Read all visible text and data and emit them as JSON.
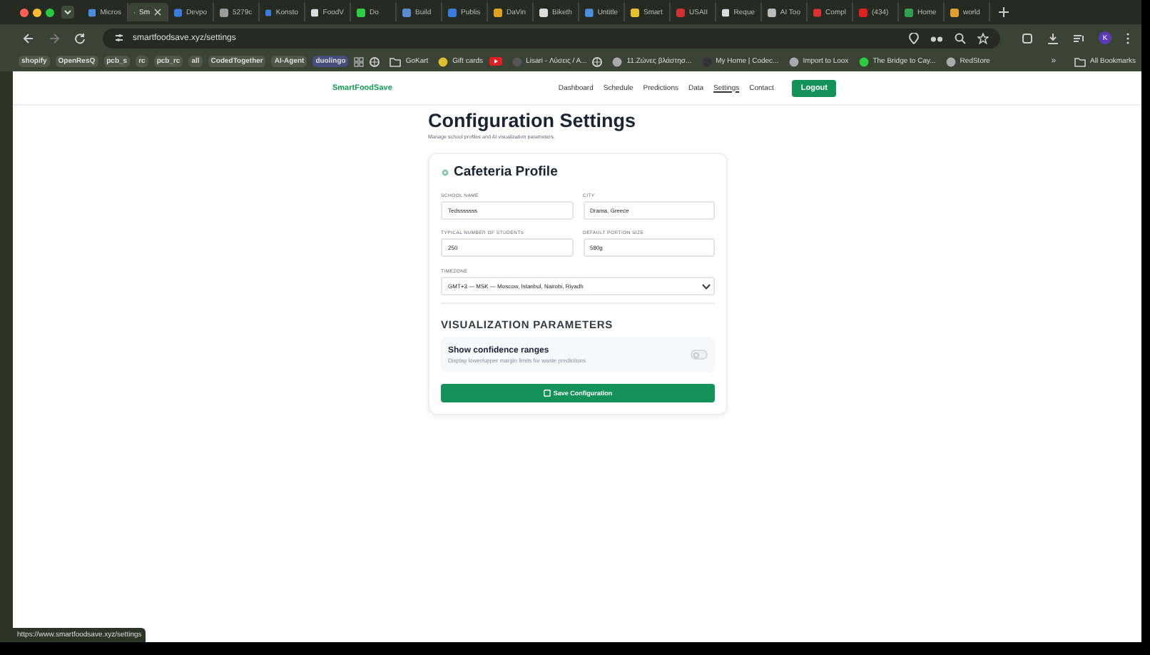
{
  "browser": {
    "tabs": [
      {
        "title": "Micros",
        "selected": false
      },
      {
        "title": "Sm",
        "selected": true
      },
      {
        "title": "Devpo",
        "selected": false
      },
      {
        "title": "5279c",
        "selected": false
      },
      {
        "title": "Konsto",
        "selected": false
      },
      {
        "title": "FoodV",
        "selected": false
      },
      {
        "title": "Do",
        "selected": false
      },
      {
        "title": "Build",
        "selected": false
      },
      {
        "title": "Publis",
        "selected": false
      },
      {
        "title": "DaVin",
        "selected": false
      },
      {
        "title": "Biketh",
        "selected": false
      },
      {
        "title": "Untitle",
        "selected": false
      },
      {
        "title": "Smart",
        "selected": false
      },
      {
        "title": "USAII",
        "selected": false
      },
      {
        "title": "Reque",
        "selected": false
      },
      {
        "title": "AI Too",
        "selected": false
      },
      {
        "title": "Compl",
        "selected": false
      },
      {
        "title": "(434)",
        "selected": false
      },
      {
        "title": "Home",
        "selected": false
      },
      {
        "title": "world",
        "selected": false
      }
    ],
    "address": "smartfoodsave.xyz/settings",
    "bookmarks": [
      {
        "kind": "chip",
        "label": "shopify"
      },
      {
        "kind": "chip",
        "label": "OpenResQ"
      },
      {
        "kind": "chip",
        "label": "pcb_s"
      },
      {
        "kind": "chip",
        "label": "rc"
      },
      {
        "kind": "chip",
        "label": "pcb_rc"
      },
      {
        "kind": "chip",
        "label": "all"
      },
      {
        "kind": "chip",
        "label": "CodedTogether"
      },
      {
        "kind": "chip",
        "label": "AI-Agent"
      },
      {
        "kind": "chip",
        "label": "duolingo"
      },
      {
        "kind": "folder",
        "label": "GoKart"
      },
      {
        "kind": "link",
        "label": "Gift cards"
      },
      {
        "kind": "link",
        "label": "Lisari - Λύσεις / Α..."
      },
      {
        "kind": "link",
        "label": "11.Ζώνες βλάστησ..."
      },
      {
        "kind": "link",
        "label": "My Home | Codec..."
      },
      {
        "kind": "link",
        "label": "Import to Loox"
      },
      {
        "kind": "link",
        "label": "The Bridge to Cay..."
      },
      {
        "kind": "link",
        "label": "RedStore"
      }
    ],
    "more": "»",
    "all_bookmarks": "All Bookmarks",
    "profile_initial": "K",
    "status_url": "https://www.smartfoodsave.xyz/settings"
  },
  "page": {
    "logo": "SmartFoodSave",
    "nav": [
      {
        "label": "Dashboard",
        "selected": false
      },
      {
        "label": "Schedule",
        "selected": false
      },
      {
        "label": "Predictions",
        "selected": false
      },
      {
        "label": "Data",
        "selected": false
      },
      {
        "label": "Settings",
        "selected": true
      },
      {
        "label": "Contact",
        "selected": false
      }
    ],
    "logout": "Logout",
    "title": "Configuration Settings",
    "subtitle": "Manage school profiles and AI visualization parameters.",
    "card_title": "Cafeteria Profile",
    "fields": [
      {
        "label": "SCHOOL NAME",
        "value": "Tedsssssss"
      },
      {
        "label": "CITY",
        "value": "Drama, Greece"
      },
      {
        "label": "TYPICAL NUMBER OF STUDENTS",
        "value": "250"
      },
      {
        "label": "DEFAULT PORTION SIZE",
        "value": "580g"
      }
    ],
    "timezone": {
      "label": "TIMEZONE",
      "value": "GMT+3 — MSK — Moscow, Istanbul, Nairobi, Riyadh"
    },
    "section": "VISUALIZATION PARAMETERS",
    "toggle": {
      "label": "Show confidence ranges",
      "hint": "Display lower/upper margin limits for waste predictions",
      "on": false
    },
    "save": "Save Configuration"
  }
}
